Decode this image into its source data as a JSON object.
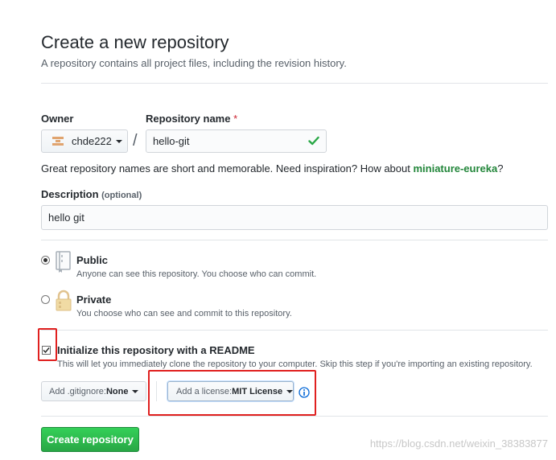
{
  "header": {
    "title": "Create a new repository",
    "subtitle": "A repository contains all project files, including the revision history."
  },
  "owner": {
    "label": "Owner",
    "value": "chde222"
  },
  "repo_name": {
    "label": "Repository name",
    "required_mark": "*",
    "separator": "/",
    "value": "hello-git",
    "valid_icon": "check-icon"
  },
  "suggestion": {
    "text": "Great repository names are short and memorable. Need inspiration? How about ",
    "name": "miniature-eureka",
    "suffix": "?"
  },
  "description": {
    "label": "Description",
    "optional": "(optional)",
    "value": "hello git"
  },
  "visibility": {
    "public": {
      "label": "Public",
      "desc": "Anyone can see this repository. You choose who can commit.",
      "icon": "repo-book-icon",
      "selected": true
    },
    "private": {
      "label": "Private",
      "desc": "You choose who can see and commit to this repository.",
      "icon": "lock-icon",
      "selected": false
    }
  },
  "readme": {
    "label": "Initialize this repository with a README",
    "desc": "This will let you immediately clone the repository to your computer. Skip this step if you're importing an existing repository.",
    "checked": true
  },
  "gitignore": {
    "prefix": "Add .gitignore: ",
    "value": "None"
  },
  "license": {
    "prefix": "Add a license: ",
    "value": "MIT License",
    "info_icon": "info-icon"
  },
  "submit": {
    "label": "Create repository"
  },
  "watermark": "https://blog.csdn.net/weixin_38383877",
  "colors": {
    "accent_green": "#28a745",
    "annotation_red": "#e0201f",
    "link_green": "#22863a"
  }
}
